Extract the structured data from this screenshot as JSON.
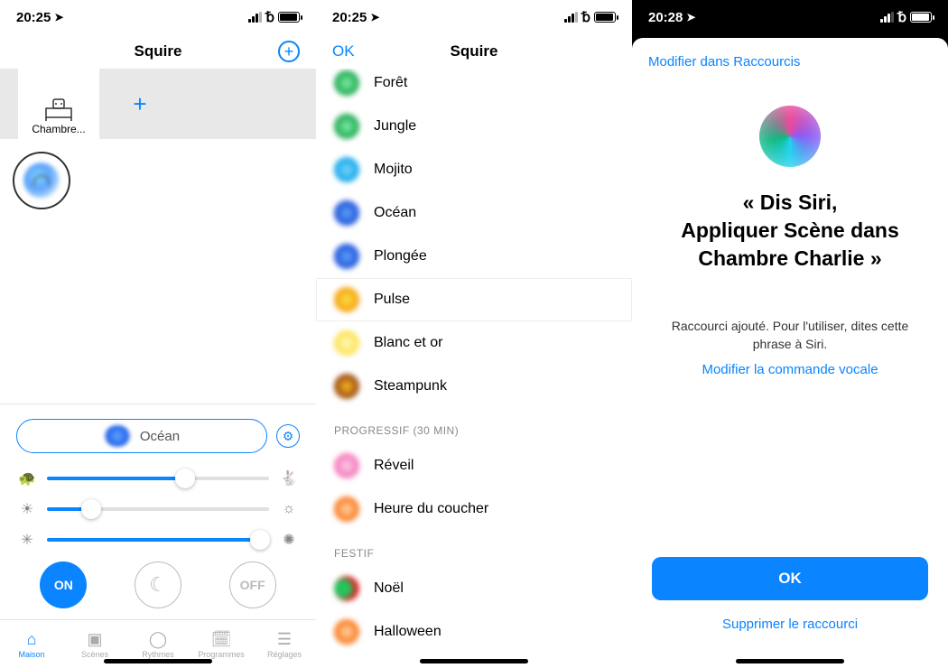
{
  "screen1": {
    "time": "20:25",
    "header_title": "Squire",
    "room_name": "Chambre...",
    "scene_name": "Océan",
    "sliders": {
      "speed": 62,
      "brightness": 20,
      "intensity": 96
    },
    "on_label": "ON",
    "off_label": "OFF",
    "tabs": {
      "maison": "Maison",
      "scenes": "Scènes",
      "rythmes": "Rythmes",
      "programmes": "Programmes",
      "reglages": "Réglages"
    }
  },
  "screen2": {
    "time": "20:25",
    "ok": "OK",
    "title": "Squire",
    "items": {
      "foret": "Forêt",
      "jungle": "Jungle",
      "mojito": "Mojito",
      "ocean": "Océan",
      "plongee": "Plongée",
      "pulse": "Pulse",
      "blancor": "Blanc et or",
      "steampunk": "Steampunk",
      "reveil": "Réveil",
      "coucher": "Heure du coucher",
      "noel": "Noël",
      "halloween": "Halloween"
    },
    "section_progressif": "PROGRESSIF (30 MIN)",
    "section_festif": "FESTIF"
  },
  "screen3": {
    "time": "20:28",
    "top_link": "Modifier dans Raccourcis",
    "siri_phrase": "« Dis Siri,\nAppliquer Scène dans Chambre Charlie »",
    "subtitle": "Raccourci ajouté. Pour l'utiliser, dites cette phrase à Siri.",
    "edit_link": "Modifier la commande vocale",
    "ok_button": "OK",
    "delete_link": "Supprimer le raccourci"
  }
}
